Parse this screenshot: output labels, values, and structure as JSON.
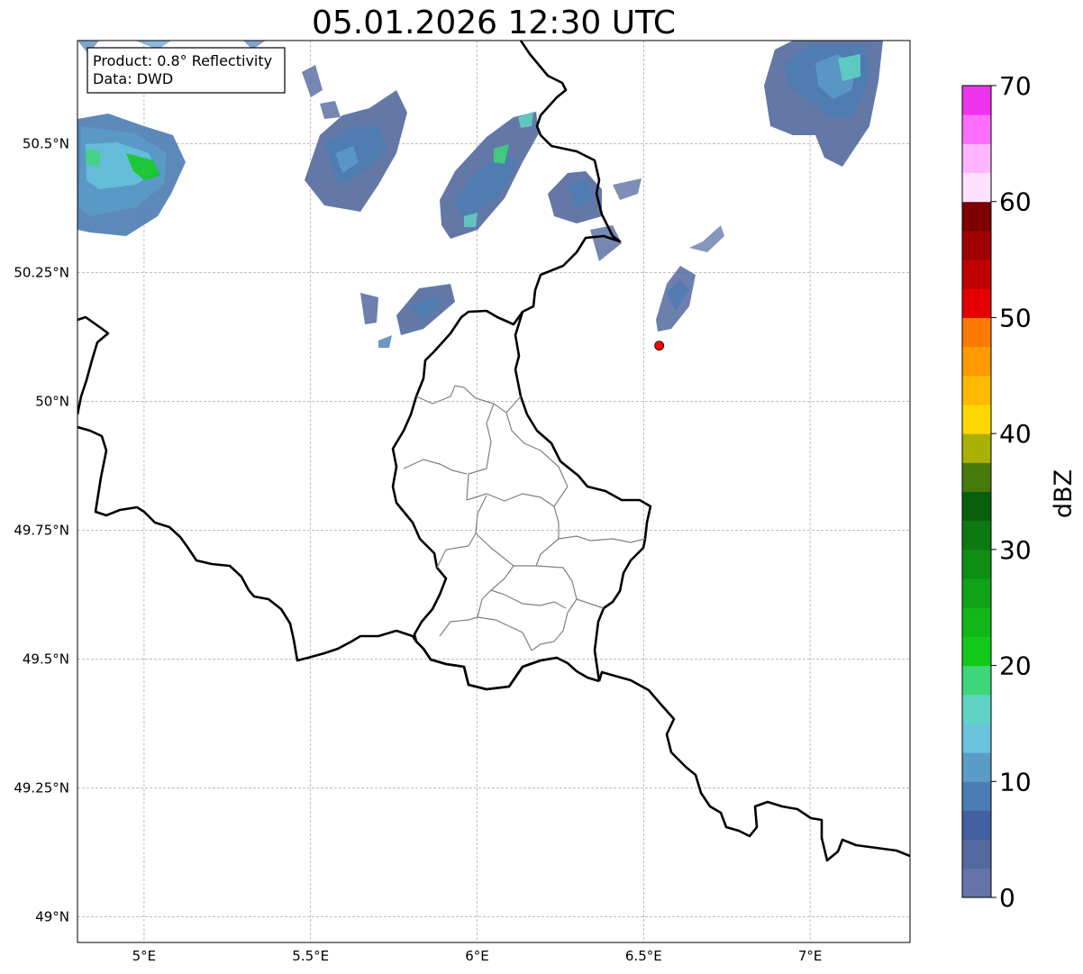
{
  "title": "05.01.2026 12:30 UTC",
  "info_box": {
    "line1": "Product: 0.8° Reflectivity",
    "line2": "Data: DWD"
  },
  "map": {
    "lon_range": [
      4.8,
      7.3
    ],
    "lat_range": [
      48.95,
      50.7
    ],
    "x_ticks": [
      {
        "value": 5.0,
        "label": "5°E"
      },
      {
        "value": 5.5,
        "label": "5.5°E"
      },
      {
        "value": 6.0,
        "label": "6°E"
      },
      {
        "value": 6.5,
        "label": "6.5°E"
      },
      {
        "value": 7.0,
        "label": "7°E"
      }
    ],
    "y_ticks": [
      {
        "value": 49.0,
        "label": "49°N"
      },
      {
        "value": 49.25,
        "label": "49.25°N"
      },
      {
        "value": 49.5,
        "label": "49.5°N"
      },
      {
        "value": 49.75,
        "label": "49.75°N"
      },
      {
        "value": 50.0,
        "label": "50°N"
      },
      {
        "value": 50.25,
        "label": "50.25°N"
      },
      {
        "value": 50.5,
        "label": "50.5°N"
      }
    ],
    "marker": {
      "lon": 6.547,
      "lat": 50.108,
      "color": "#ff0000"
    },
    "country_border_color": "#000000",
    "canton_border_color": "#808080",
    "grid": true
  },
  "colorbar": {
    "label": "dBZ",
    "min": 0,
    "max": 70,
    "ticks": [
      {
        "value": 0,
        "label": "0"
      },
      {
        "value": 10,
        "label": "10"
      },
      {
        "value": 20,
        "label": "20"
      },
      {
        "value": 30,
        "label": "30"
      },
      {
        "value": 40,
        "label": "40"
      },
      {
        "value": 50,
        "label": "50"
      },
      {
        "value": 60,
        "label": "60"
      },
      {
        "value": 70,
        "label": "70"
      }
    ],
    "colors": [
      "#6574a8",
      "#53699f",
      "#425fa2",
      "#4b7cb3",
      "#5a9bc8",
      "#68c3dd",
      "#60d4c4",
      "#3ed67a",
      "#12c91a",
      "#11b719",
      "#10a317",
      "#0e8f14",
      "#0c7a10",
      "#085f0b",
      "#467a0b",
      "#abb004",
      "#ffd700",
      "#ffb900",
      "#ff9a00",
      "#ff7b00",
      "#e30000",
      "#c10000",
      "#9f0000",
      "#7e0000",
      "#ffe0ff",
      "#ffb5ff",
      "#ff6eff",
      "#ee33ee"
    ]
  }
}
